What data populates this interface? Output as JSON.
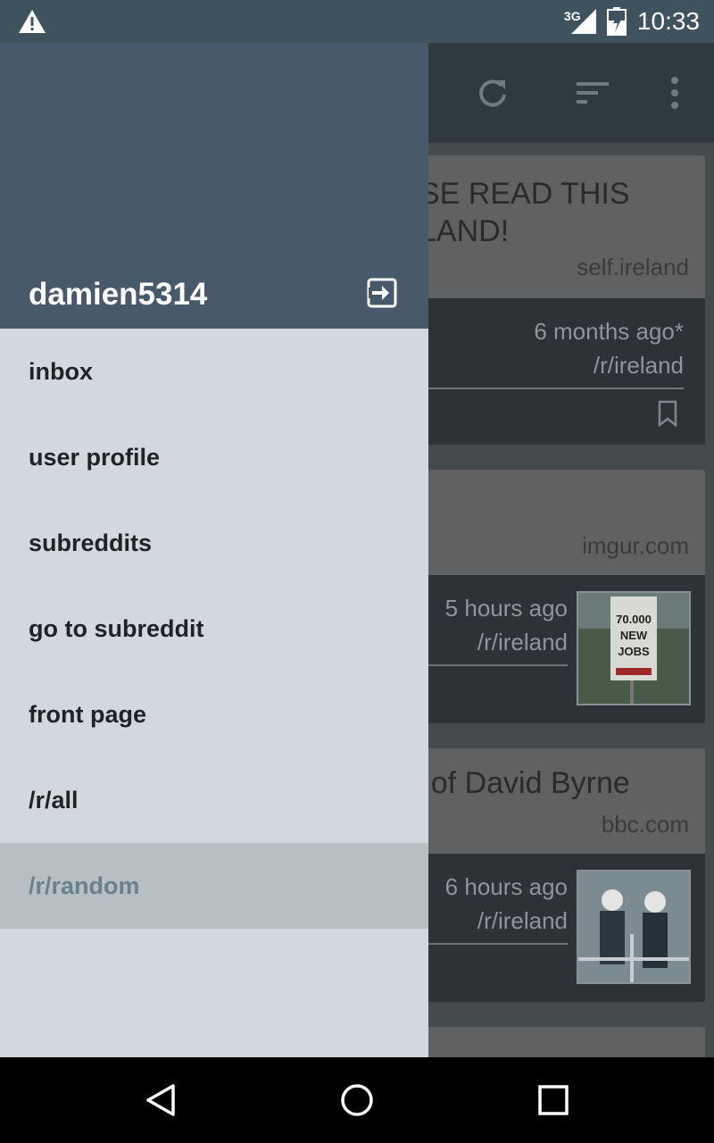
{
  "status_bar": {
    "network": "3G",
    "time": "10:33",
    "icons": [
      "warning-icon",
      "signal-icon",
      "battery-icon"
    ]
  },
  "toolbar": {
    "icons": [
      "refresh-icon",
      "sort-icon",
      "more-vert-icon"
    ]
  },
  "posts": [
    {
      "title": "SE READ THIS LAND!",
      "title_line1": "SE READ THIS",
      "title_line2": "LAND!",
      "domain": "self.ireland",
      "age": "6 months ago*",
      "subreddit": "/r/ireland",
      "has_thumbnail": false
    },
    {
      "title": "",
      "domain": "imgur.com",
      "age": "5 hours ago",
      "subreddit": "/r/ireland",
      "has_thumbnail": true,
      "thumbnail_text": [
        "70.000",
        "NEW",
        "JOBS"
      ]
    },
    {
      "title": "r of David Byrne",
      "domain": "bbc.com",
      "age": "6 hours ago",
      "subreddit": "/r/ireland",
      "has_thumbnail": true
    }
  ],
  "drawer": {
    "username": "damien5314",
    "menu": [
      {
        "label": "inbox"
      },
      {
        "label": "user profile"
      },
      {
        "label": "subreddits"
      },
      {
        "label": "go to subreddit"
      },
      {
        "label": "front page"
      },
      {
        "label": "/r/all"
      },
      {
        "label": "/r/random",
        "active": true
      }
    ]
  },
  "nav_bar": {
    "icons": [
      "back-icon",
      "home-icon",
      "recents-icon"
    ]
  },
  "colors": {
    "status_bar": "#3f535f",
    "drawer_header": "#47596a",
    "drawer_body": "#d1d9df",
    "active_item_bg": "#b7bfc3",
    "active_item_text": "#6a8090"
  }
}
